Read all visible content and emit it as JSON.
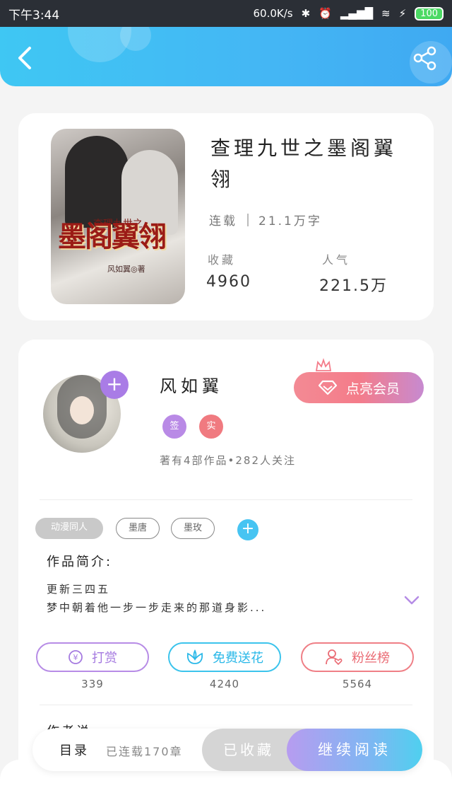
{
  "status_bar": {
    "time": "下午3:44",
    "network_speed": "60.0K/s",
    "battery": "100"
  },
  "header": {
    "back_icon": "chevron-left-icon",
    "share_icon": "share-icon"
  },
  "book": {
    "title": "查理九世之墨阁翼翎",
    "cover_title_small": "查理九世之",
    "cover_title_big": "墨阁翼翎",
    "cover_author_tag": "风如翼◎著",
    "status": "连载",
    "word_count": "21.1万字",
    "collect_label": "收藏",
    "collect_value": "4960",
    "popularity_label": "人气",
    "popularity_value": "221.5万"
  },
  "author": {
    "name": "风如翼",
    "badge_signed": "签",
    "badge_verified": "实",
    "works_info": "著有4部作品•282人关注",
    "vip_button": "点亮会员"
  },
  "tags": [
    "动漫同人",
    "墨唐",
    "墨玫"
  ],
  "intro": {
    "title": "作品简介:",
    "line1": "更新三四五",
    "line2": "梦中朝着他一步一步走来的那道身影..."
  },
  "actions": {
    "reward_label": "打赏",
    "reward_count": "339",
    "flower_label": "免费送花",
    "flower_count": "4240",
    "fans_label": "粉丝榜",
    "fans_count": "5564"
  },
  "author_says_label": "作者说",
  "bottom_bar": {
    "toc_label": "目录",
    "chapters": "已连载170章",
    "collected_label": "已收藏",
    "read_label": "继续阅读"
  },
  "colors": {
    "header_blue": "#3fc7f3",
    "purple": "#a97ce6",
    "pink": "#f47c8a",
    "cyan": "#3cc4ec"
  }
}
